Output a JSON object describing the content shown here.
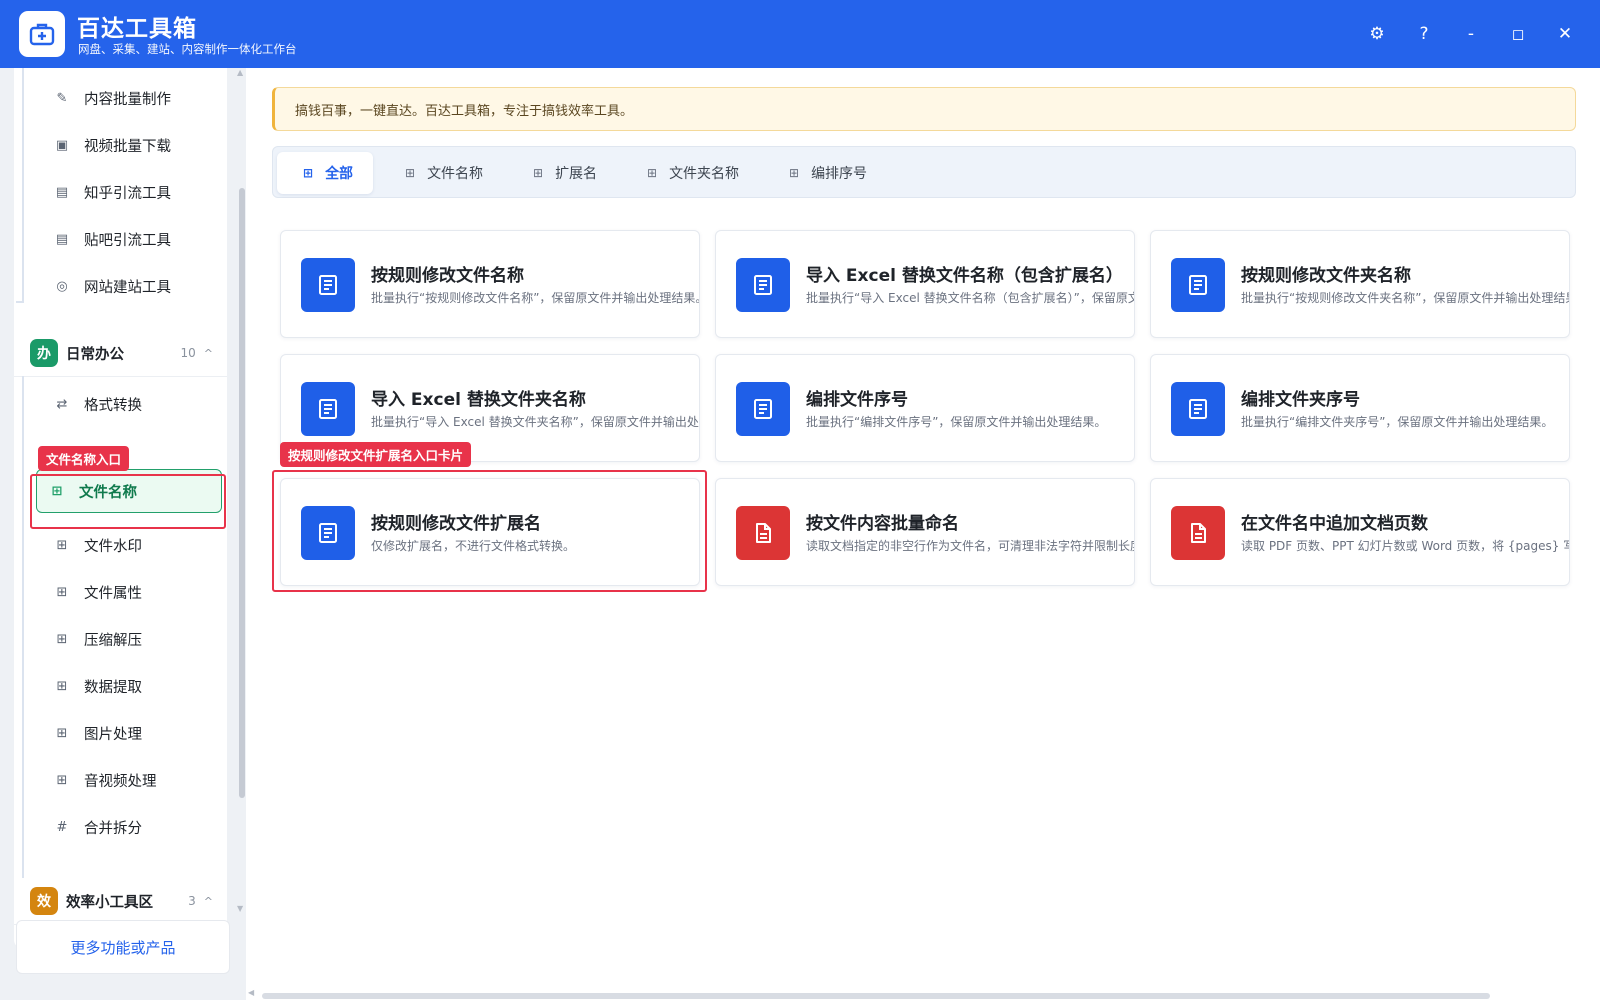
{
  "app": {
    "title": "百达工具箱",
    "subtitle": "网盘、采集、建站、内容制作一体化工作台",
    "colors": {
      "titlebar": "#2563eb",
      "accent": "#2563eb",
      "active_green": "#22a06b",
      "annotation_red": "#e8334a",
      "card_icon_blue": "#1f5fe8",
      "card_icon_red": "#dc3535"
    }
  },
  "window_controls": {
    "settings_icon": "gear-icon",
    "settings_glyph": "⚙",
    "help_icon": "help-icon",
    "help_glyph": "?",
    "minimize_glyph": "-",
    "maximize_glyph": "◻",
    "close_glyph": "✕"
  },
  "sidebar": {
    "top_items": [
      {
        "label": "内容批量制作",
        "icon": "pen-icon",
        "glyph": "✎"
      },
      {
        "label": "视频批量下载",
        "icon": "video-icon",
        "glyph": "▣"
      },
      {
        "label": "知乎引流工具",
        "icon": "zhihu-icon",
        "glyph": "▤"
      },
      {
        "label": "贴吧引流工具",
        "icon": "tieba-icon",
        "glyph": "▤"
      },
      {
        "label": "网站建站工具",
        "icon": "website-icon",
        "glyph": "◎"
      }
    ],
    "group_daily": {
      "badge": "办",
      "badge_color": "#1a9a68",
      "name": "日常办公",
      "count": "10",
      "caret": "^",
      "items": [
        {
          "label": "格式转换",
          "icon": "swap-icon",
          "glyph": "⇄"
        },
        {
          "label": "文件名称",
          "icon": "grid-icon",
          "glyph": "⊞",
          "active": true
        },
        {
          "label": "文件水印",
          "icon": "grid-icon",
          "glyph": "⊞"
        },
        {
          "label": "文件属性",
          "icon": "grid-icon",
          "glyph": "⊞"
        },
        {
          "label": "压缩解压",
          "icon": "grid-icon",
          "glyph": "⊞"
        },
        {
          "label": "数据提取",
          "icon": "grid-icon",
          "glyph": "⊞"
        },
        {
          "label": "图片处理",
          "icon": "grid-icon",
          "glyph": "⊞"
        },
        {
          "label": "音视频处理",
          "icon": "grid-icon",
          "glyph": "⊞"
        },
        {
          "label": "合并拆分",
          "icon": "hash-icon",
          "glyph": "#"
        }
      ]
    },
    "group_efficiency": {
      "badge": "效",
      "badge_color": "#d4850f",
      "name": "效率小工具区",
      "count": "3",
      "caret": "^"
    },
    "more_label": "更多功能或产品"
  },
  "annotations": {
    "sidebar_tag": "文件名称入口",
    "card_tag": "按规则修改文件扩展名入口卡片"
  },
  "notice": "搞钱百事，一键直达。百达工具箱，专注于搞钱效率工具。",
  "tabs": [
    {
      "label": "全部",
      "glyph": "⊞",
      "active": true
    },
    {
      "label": "文件名称",
      "glyph": "⊞"
    },
    {
      "label": "扩展名",
      "glyph": "⊞"
    },
    {
      "label": "文件夹名称",
      "glyph": "⊞"
    },
    {
      "label": "编排序号",
      "glyph": "⊞"
    }
  ],
  "cards": [
    {
      "title": "按规则修改文件名称",
      "desc": "批量执行“按规则修改文件名称”，保留原文件并输出处理结果。",
      "icon": "document-icon",
      "color": "blue"
    },
    {
      "title": "导入 Excel 替换文件名称（包含扩展名）",
      "desc": "批量执行“导入 Excel 替换文件名称（包含扩展名）”，保留原文件",
      "icon": "document-icon",
      "color": "blue"
    },
    {
      "title": "按规则修改文件夹名称",
      "desc": "批量执行“按规则修改文件夹名称”，保留原文件并输出处理结果。",
      "icon": "document-icon",
      "color": "blue"
    },
    {
      "title": "导入 Excel 替换文件夹名称",
      "desc": "批量执行“导入 Excel 替换文件夹名称”，保留原文件并输出处理结",
      "icon": "document-icon",
      "color": "blue"
    },
    {
      "title": "编排文件序号",
      "desc": "批量执行“编排文件序号”，保留原文件并输出处理结果。",
      "icon": "document-icon",
      "color": "blue"
    },
    {
      "title": "编排文件夹序号",
      "desc": "批量执行“编排文件夹序号”，保留原文件并输出处理结果。",
      "icon": "document-icon",
      "color": "blue"
    },
    {
      "title": "按规则修改文件扩展名",
      "desc": "仅修改扩展名，不进行文件格式转换。",
      "icon": "document-icon",
      "color": "blue"
    },
    {
      "title": "按文件内容批量命名",
      "desc": "读取文档指定的非空行作为文件名，可清理非法字符并限制长度；",
      "icon": "file-text-icon",
      "color": "red"
    },
    {
      "title": "在文件名中追加文档页数",
      "desc": "读取 PDF 页数、PPT 幻灯片数或 Word 页数，将 {pages} 写入命名",
      "icon": "file-text-icon",
      "color": "red"
    }
  ]
}
